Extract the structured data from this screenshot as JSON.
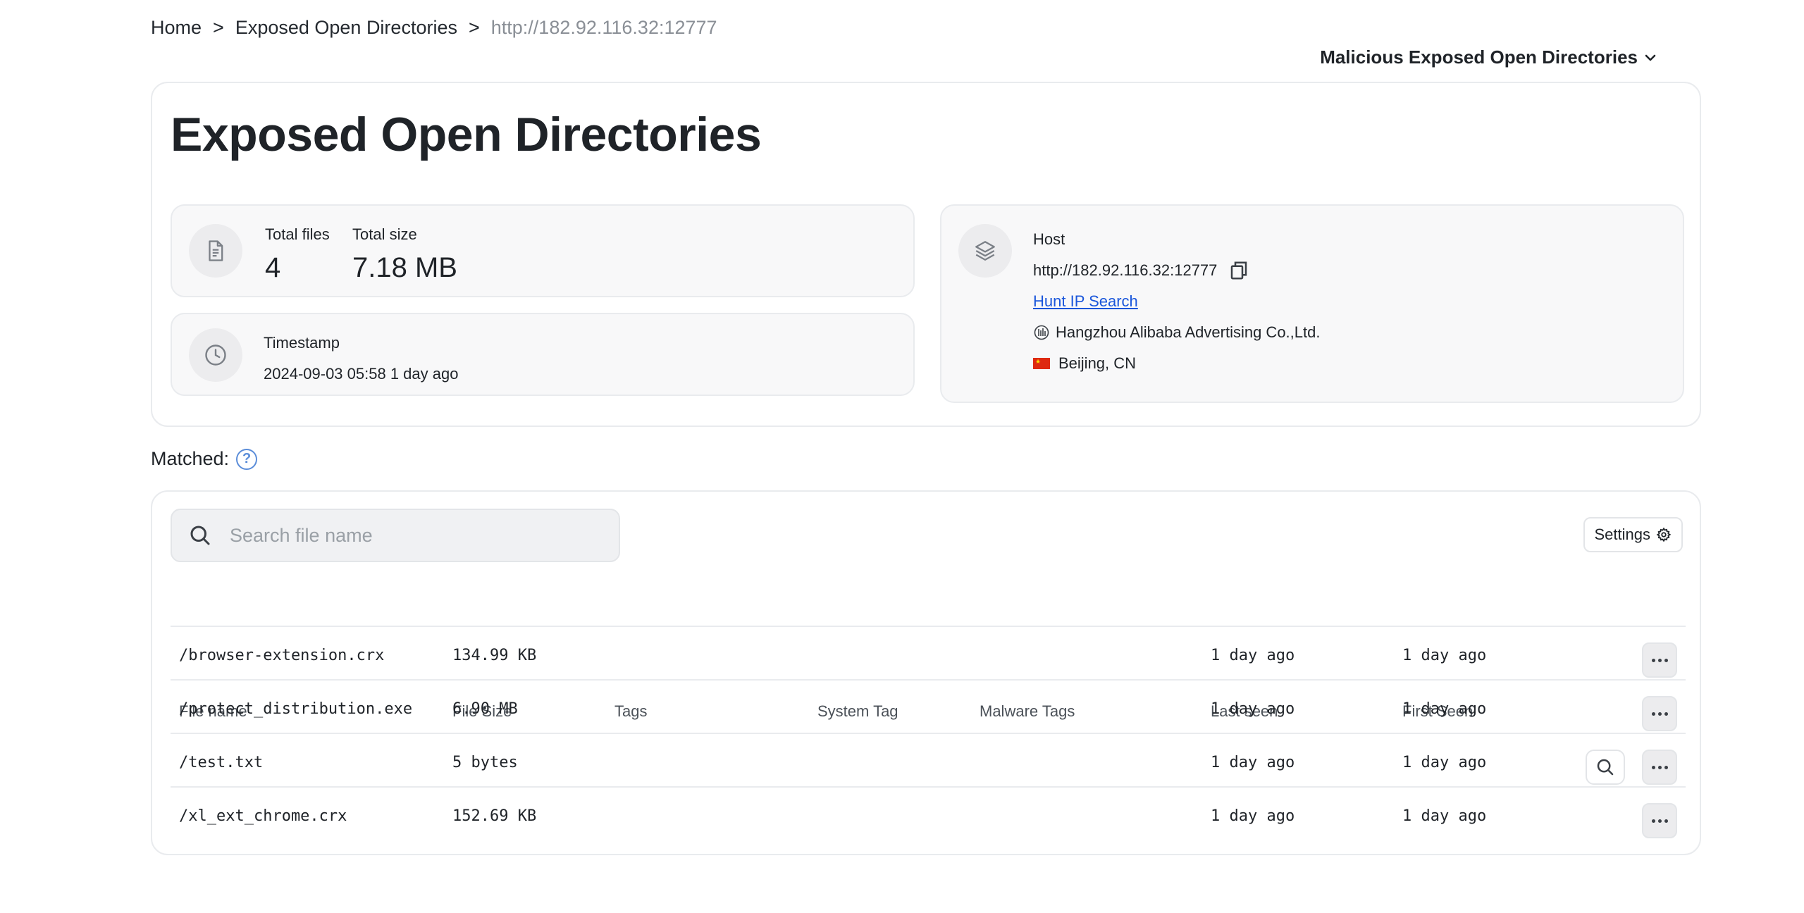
{
  "breadcrumb": {
    "home": "Home",
    "section": "Exposed Open Directories",
    "current_prefix": "http://",
    "current_ip": "182.92.116.32",
    "current_port": ":12777",
    "separator": ">"
  },
  "top_dropdown": {
    "label": "Malicious Exposed Open Directories"
  },
  "page": {
    "title": "Exposed Open Directories"
  },
  "stats": {
    "total_files_label": "Total files",
    "total_files_value": "4",
    "total_size_label": "Total size",
    "total_size_value": "7.18 MB"
  },
  "timestamp": {
    "label": "Timestamp",
    "value": "2024-09-03 05:58 1 day ago"
  },
  "host": {
    "label": "Host",
    "url_prefix": "http://",
    "ip": "182.92.116.32",
    "port": ":12777",
    "search_link": "Hunt IP Search",
    "org": "Hangzhou Alibaba Advertising Co.,Ltd.",
    "location": "Beijing, CN"
  },
  "matched": {
    "label": "Matched:"
  },
  "search": {
    "placeholder": "Search file name"
  },
  "settings": {
    "label": "Settings"
  },
  "table": {
    "headers": {
      "name": "File name",
      "size": "File Size",
      "tags": "Tags",
      "system_tag": "System Tag",
      "malware_tags": "Malware Tags",
      "last_seen": "Last seen",
      "first_seen": "First Seen"
    },
    "rows": [
      {
        "name": "/browser-extension.crx",
        "size": "134.99 KB",
        "last_seen": "1 day ago",
        "first_seen": "1 day ago"
      },
      {
        "name": "/protect_distribution.exe",
        "size": "6.90 MB",
        "last_seen": "1 day ago",
        "first_seen": "1 day ago"
      },
      {
        "name": "/test.txt",
        "size": "5 bytes",
        "last_seen": "1 day ago",
        "first_seen": "1 day ago"
      },
      {
        "name": "/xl_ext_chrome.crx",
        "size": "152.69 KB",
        "last_seen": "1 day ago",
        "first_seen": "1 day ago"
      }
    ]
  }
}
